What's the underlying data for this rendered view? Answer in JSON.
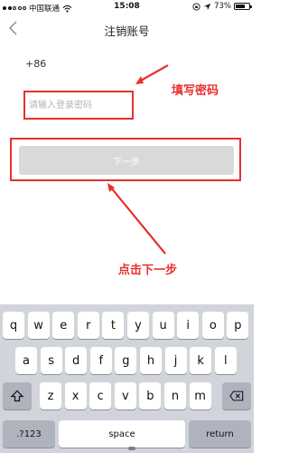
{
  "status_bar": {
    "carrier": "中国联通",
    "time": "15:08",
    "battery_percent": "73%",
    "battery_level": 0.73
  },
  "nav": {
    "title": "注销账号",
    "back_icon": "chevron-left-icon"
  },
  "form": {
    "country_code": "+86",
    "password_placeholder": "请输入登录密码",
    "password_value": "",
    "next_label": "下一步"
  },
  "annotations": {
    "fill_password": "填写密码",
    "click_next": "点击下一步",
    "color": "#e8302c"
  },
  "keyboard": {
    "row1": [
      "q",
      "w",
      "e",
      "r",
      "t",
      "y",
      "u",
      "i",
      "o",
      "p"
    ],
    "row2": [
      "a",
      "s",
      "d",
      "f",
      "g",
      "h",
      "j",
      "k",
      "l"
    ],
    "row3": [
      "z",
      "x",
      "c",
      "v",
      "b",
      "n",
      "m"
    ],
    "shift_icon": "shift-icon",
    "delete_icon": "delete-icon",
    "numbers_label": ".?123",
    "space_label": "space",
    "return_label": "return"
  },
  "colors": {
    "button_disabled": "#d9d9d9",
    "keyboard_bg": "#d1d4da",
    "function_key": "#aeb3bd"
  }
}
